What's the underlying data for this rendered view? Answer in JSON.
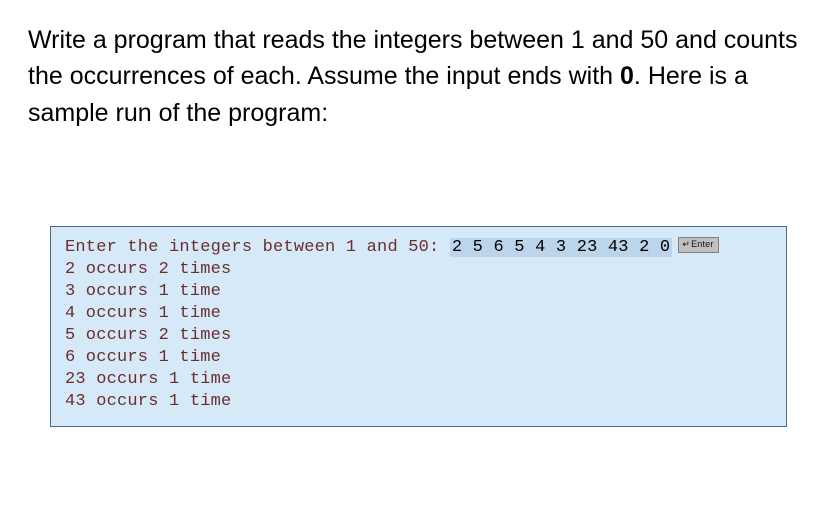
{
  "problem": {
    "pre_bold": "Write a program that reads the integers between 1 and 50 and counts the occurrences of each. Assume the input ends with ",
    "bold": "0",
    "post_bold": ". Here is a sample run of the program:"
  },
  "sample": {
    "prompt": "Enter the integers between 1 and 50: ",
    "input": "2 5 6 5 4 3 23 43 2 0",
    "enter_label": "Enter",
    "lines": [
      "2 occurs 2 times",
      "3 occurs 1 time",
      "4 occurs 1 time",
      "5 occurs 2 times",
      "6 occurs 1 time",
      "23 occurs 1 time",
      "43 occurs 1 time"
    ]
  }
}
